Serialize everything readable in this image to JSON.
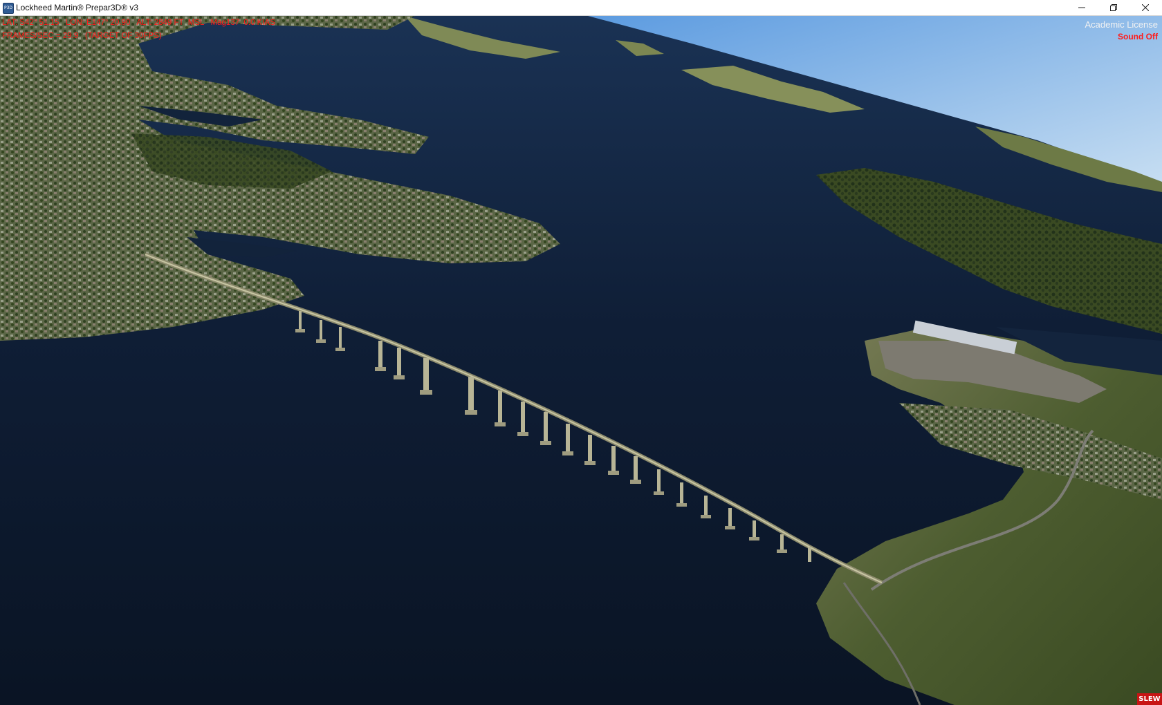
{
  "window": {
    "title": "Lockheed Martin® Prepar3D® v3",
    "icon": "p3d-app-icon",
    "icon_text": "P3D",
    "controls": [
      "minimize-icon",
      "restore-icon",
      "close-icon"
    ]
  },
  "hud": {
    "line1": "LAT: S42° 51.15   LON: E147° 20.90   ALT: 2849 FT  MSL   Mag137  0.0 KIAS",
    "line2": "FRAMES/SEC = 29.9   (TARGET OF 30FPS)",
    "license": "Academic License",
    "sound": "Sound Off",
    "mode_badge": "SLEW",
    "color": "#ff1b1b"
  },
  "scene": {
    "description_colors": {
      "sky": "#7fb4e6",
      "water": "#0e1b30",
      "land": "#5a6a3a"
    }
  }
}
